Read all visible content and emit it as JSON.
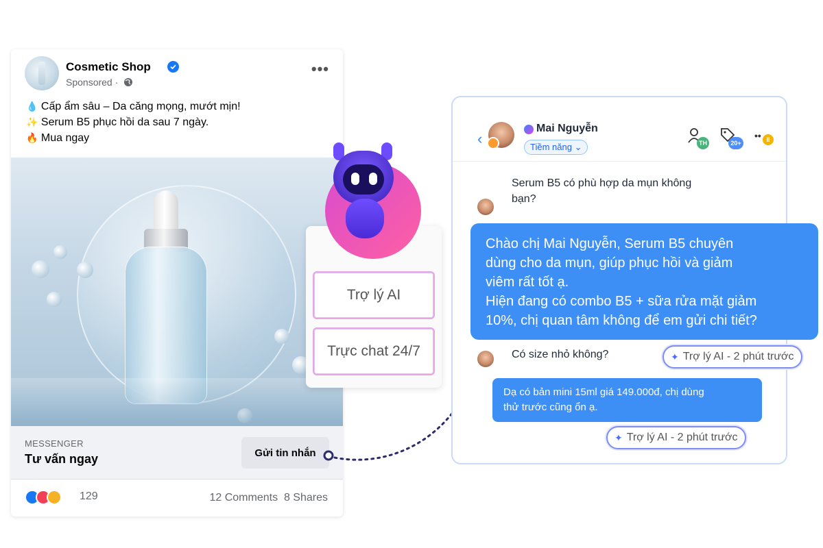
{
  "ad": {
    "page_name": "Cosmetic Shop",
    "sponsored": "Sponsored ·",
    "lines": [
      {
        "emoji": "💧",
        "text": "Cấp ẩm sâu – Da căng mọng, mướt mịn!"
      },
      {
        "emoji": "✨",
        "text": "Serum B5 phục hồi da sau 7 ngày."
      },
      {
        "emoji": "🔥",
        "text": "Mua ngay"
      }
    ],
    "cta_label": "MESSENGER",
    "cta_title": "Tư vấn ngay",
    "cta_button": "Gửi tin nhắn",
    "reaction_count": "129",
    "stats": "12 Comments  8 Shares"
  },
  "options": {
    "ai_assistant": "Trợ lý AI",
    "live_chat": "Trực chat 24/7"
  },
  "chat": {
    "contact_name": "Mai Nguyễn",
    "tag": "Tiềm năng",
    "header_badges": {
      "assignee": "TH",
      "tags": "20+",
      "status": "II"
    },
    "messages": {
      "q1_line1": "Serum B5 có phù hợp da mụn không",
      "q1_line2": "bạn?",
      "reply1": [
        "Chào chị Mai Nguyễn, Serum B5 chuyên",
        "dùng cho da mụn, giúp phục hồi và giảm",
        "viêm rất tốt ạ.",
        "Hiện đang có combo B5 + sữa rửa mặt giảm",
        "10%, chị quan tâm không để em gửi chi tiết?"
      ],
      "q2": "Có size nhỏ không?",
      "reply2": [
        "Dạ có bản mini 15ml giá 149.000đ, chị dùng",
        "thử trước cũng ổn ạ."
      ],
      "ai_chip_1": "Trợ lý AI - 2 phút trước",
      "ai_chip_2": "Trợ lý AI - 2 phút trước"
    }
  },
  "colors": {
    "facebook_blue": "#1877f2",
    "chat_bubble": "#3d8ef5",
    "robot_gradient": "#d84cd0"
  }
}
